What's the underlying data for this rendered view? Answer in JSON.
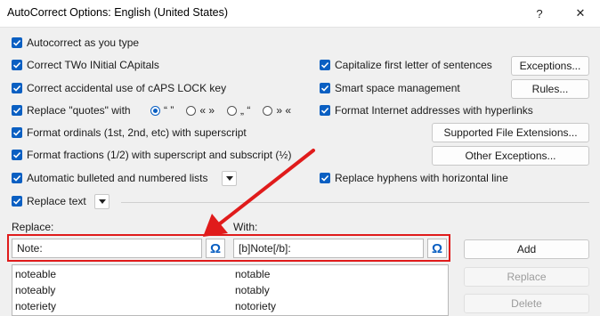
{
  "window": {
    "title": "AutoCorrect Options: English (United States)",
    "help_label": "?",
    "close_label": "✕"
  },
  "options_left": [
    {
      "label": "Autocorrect as you type",
      "checked": true
    },
    {
      "label": "Correct TWo INitial CApitals",
      "checked": true
    },
    {
      "label": "Correct accidental use of cAPS LOCK key",
      "checked": true
    },
    {
      "label": "Replace \"quotes\" with",
      "checked": true
    },
    {
      "label": "Format ordinals (1st, 2nd, etc) with superscript",
      "checked": true
    },
    {
      "label": "Format fractions (1/2) with superscript and subscript (½)",
      "checked": true
    },
    {
      "label": "Automatic bulleted and numbered lists",
      "checked": true
    },
    {
      "label": "Replace text",
      "checked": true
    }
  ],
  "options_right": [
    {
      "label": "Capitalize first letter of sentences",
      "checked": true
    },
    {
      "label": "Smart space management",
      "checked": true
    },
    {
      "label": "Format Internet addresses with hyperlinks",
      "checked": true
    },
    {
      "label": "Replace hyphens with horizontal line",
      "checked": true
    }
  ],
  "quote_styles": [
    {
      "label": "“ ”",
      "selected": true
    },
    {
      "label": "« »",
      "selected": false
    },
    {
      "label": "„ “",
      "selected": false
    },
    {
      "label": "» «",
      "selected": false
    }
  ],
  "buttons": {
    "exceptions": "Exceptions...",
    "rules": "Rules...",
    "supported_extensions": "Supported File Extensions...",
    "other_exceptions": "Other Exceptions...",
    "add": "Add",
    "replace": "Replace",
    "delete": "Delete"
  },
  "replace_section": {
    "replace_label": "Replace:",
    "with_label": "With:",
    "replace_value": "Note:",
    "with_value": "[b]Note[/b]:",
    "omega_symbol": "Ω"
  },
  "entries": [
    {
      "replace": "noteable",
      "with": "notable"
    },
    {
      "replace": "noteably",
      "with": "notably"
    },
    {
      "replace": "noteriety",
      "with": "notoriety"
    }
  ],
  "colors": {
    "accent": "#0a5fc2",
    "annotation": "#e01b1b"
  }
}
